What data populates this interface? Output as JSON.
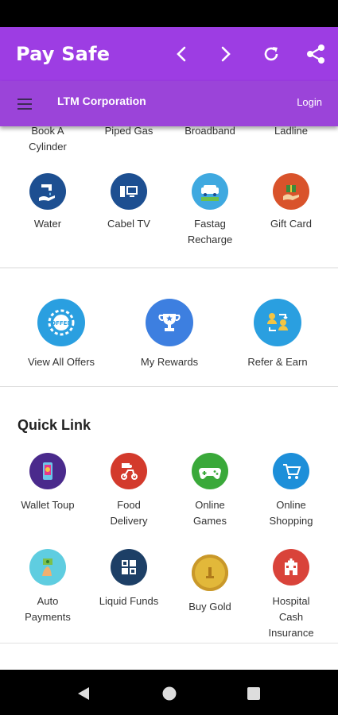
{
  "app": {
    "title": "Pay Safe",
    "company": "LTM Corporation",
    "login_label": "Login"
  },
  "top_row": [
    {
      "label": "Book A\nCylinder"
    },
    {
      "label": "Piped Gas"
    },
    {
      "label": "Broadband"
    },
    {
      "label": "Ladline"
    }
  ],
  "services": [
    {
      "label": "Water",
      "icon": "water-icon",
      "color": "#1d4f91"
    },
    {
      "label": "Cabel TV",
      "icon": "tv-icon",
      "color": "#1d4f91"
    },
    {
      "label": "Fastag\nRecharge",
      "icon": "fastag-icon",
      "color": "#3fa9e0"
    },
    {
      "label": "Gift Card",
      "icon": "gift-card-icon",
      "color": "#d9532b"
    }
  ],
  "offers": [
    {
      "label": "View All Offers",
      "icon": "offer-badge-icon",
      "color": "#2a9fe0"
    },
    {
      "label": "My Rewards",
      "icon": "trophy-icon",
      "color": "#3d7fe0"
    },
    {
      "label": "Refer & Earn",
      "icon": "refer-icon",
      "color": "#2a9fe0"
    }
  ],
  "quick_link": {
    "title": "Quick Link",
    "items": [
      {
        "label": "Wallet Toup",
        "icon": "wallet-icon",
        "color": "#4a2a8c"
      },
      {
        "label": "Food\nDelivery",
        "icon": "food-delivery-icon",
        "color": "#d33a2c"
      },
      {
        "label": "Online\nGames",
        "icon": "gamepad-icon",
        "color": "#3aa93a"
      },
      {
        "label": "Online\nShopping",
        "icon": "cart-icon",
        "color": "#1d8fd9"
      },
      {
        "label": "Auto\nPayments",
        "icon": "auto-payment-icon",
        "color": "#5fcde0"
      },
      {
        "label": "Liquid Funds",
        "icon": "liquid-funds-icon",
        "color": "#1d3f66"
      },
      {
        "label": "Buy Gold",
        "icon": "gold-coin-icon",
        "color": "#e2b83a"
      },
      {
        "label": "Hospital\nCash\nInsurance",
        "icon": "hospital-icon",
        "color": "#d9433a"
      }
    ]
  }
}
